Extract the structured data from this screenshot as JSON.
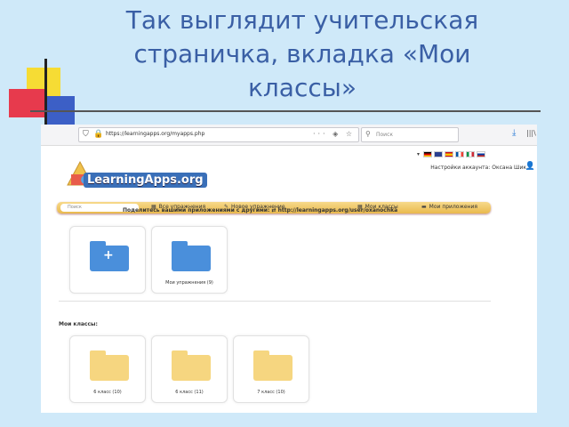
{
  "slide": {
    "title": "Так выглядит учительская страничка, вкладка «Мои классы»"
  },
  "browser": {
    "url": "https://learningapps.org/myapps.php",
    "search_placeholder": "Поиск",
    "url_actions": "··· ◈ ☆"
  },
  "site": {
    "logo_text": "LearningApps.org",
    "user_line": "Настройки аккаунта: Оксана Шик",
    "nav": {
      "search_placeholder": "Поиск",
      "all_exercises": "Все упражнения",
      "new_exercise": "Новое упражнение",
      "my_classes": "Мои классы",
      "my_apps": "Мои приложения"
    },
    "share_line": "Поделитесь вашими приложениями с другими: ⇄ http://learningapps.org/user/oxanochka",
    "tiles_top": [
      {
        "label": "",
        "kind": "new-folder",
        "color": "#4a8fdb"
      },
      {
        "label": "Мои упражнения (9)",
        "kind": "folder",
        "color": "#4a8fdb"
      }
    ],
    "classes_heading": "Мои классы:",
    "class_tiles": [
      {
        "label": "6 класс (10)",
        "color": "#f6d680"
      },
      {
        "label": "6 класс (11)",
        "color": "#f6d680"
      },
      {
        "label": "7 класс (10)",
        "color": "#f6d680"
      }
    ]
  },
  "colors": {
    "title": "#3a5fa5",
    "nav": "#e9b94d",
    "folder_blue": "#4a8fdb",
    "folder_yellow": "#f6d680"
  }
}
